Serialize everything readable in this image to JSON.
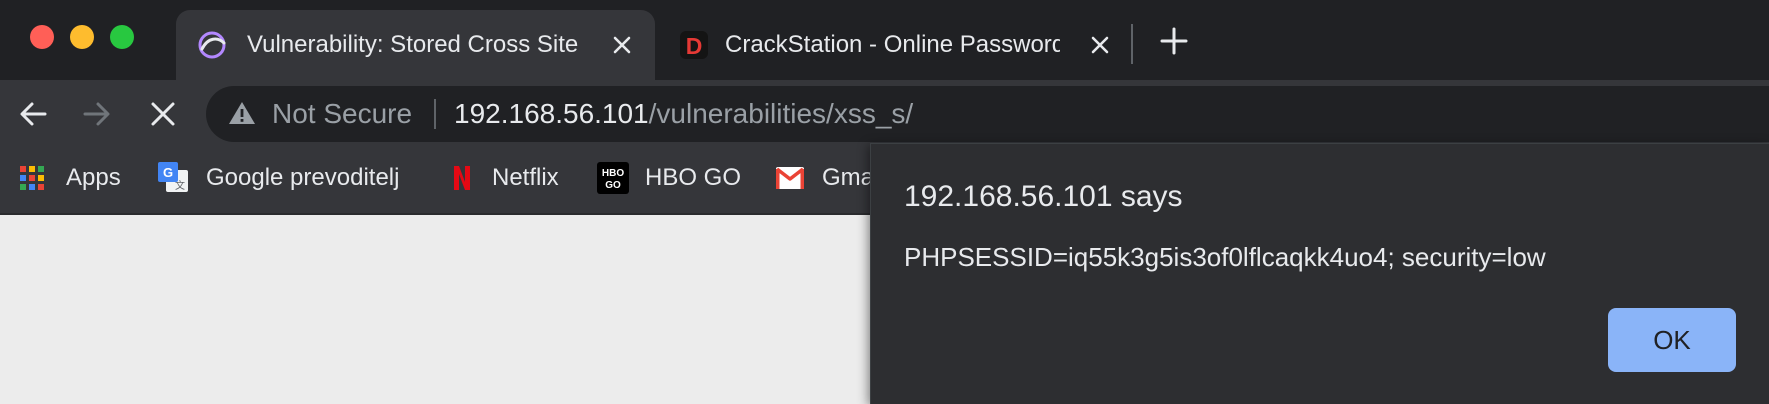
{
  "window": {
    "traffic_colors": {
      "close": "#ff5f57",
      "minimize": "#febc2e",
      "zoom": "#28c840"
    }
  },
  "tabs": [
    {
      "title": "Vulnerability: Stored Cross Site Scripting (XSS)",
      "favicon": "dvwa-icon",
      "active": true
    },
    {
      "title": "CrackStation - Online Password Hash Cracking",
      "favicon": "crackstation-icon",
      "active": false
    }
  ],
  "omnibox": {
    "security_label": "Not Secure",
    "host": "192.168.56.101",
    "path": "/vulnerabilities/xss_s/"
  },
  "bookmarks": [
    {
      "label": "Apps",
      "icon": "apps-grid-icon"
    },
    {
      "label": "Google prevoditelj",
      "icon": "google-translate-icon"
    },
    {
      "label": "Netflix",
      "icon": "netflix-icon"
    },
    {
      "label": "HBO GO",
      "icon": "hbo-go-icon"
    },
    {
      "label": "Gmail",
      "icon": "gmail-icon"
    }
  ],
  "alert": {
    "title": "192.168.56.101 says",
    "message": "PHPSESSID=iq55k3g5is3of0lflcaqkk4uo4; security=low",
    "ok_label": "OK"
  },
  "colors": {
    "tabstrip": "#202124",
    "toolbar": "#35363a",
    "page": "#ececec",
    "dialog": "#2d2e31",
    "ok_button": "#8ab4f8",
    "netflix_red": "#e50914",
    "crackstation_red": "#d32f2f"
  }
}
